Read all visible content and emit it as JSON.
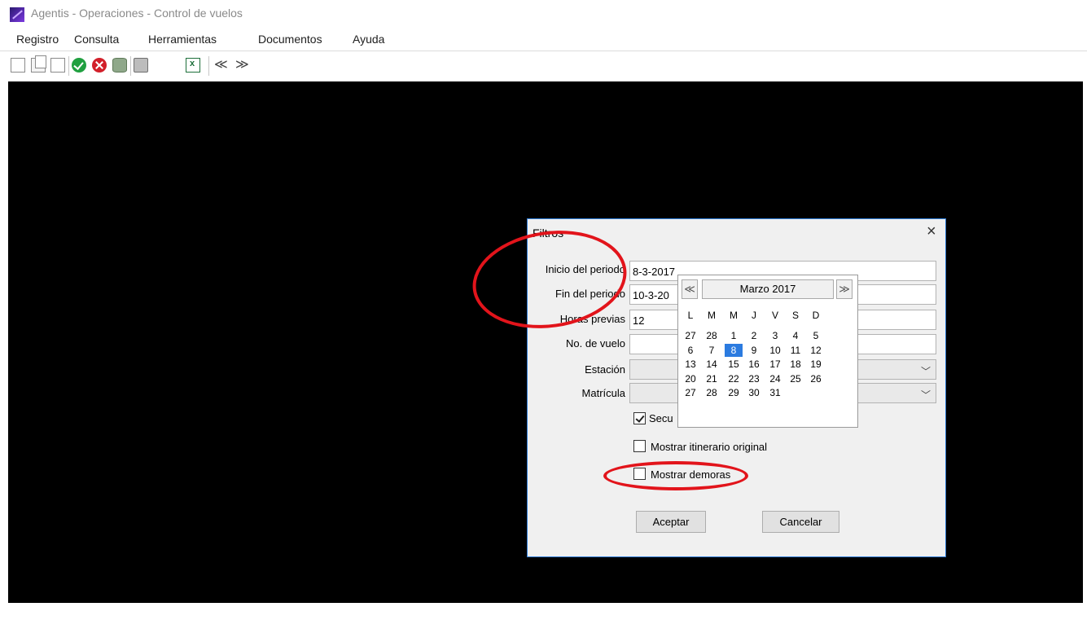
{
  "window": {
    "title": "Agentis - Operaciones - Control de vuelos"
  },
  "menu": [
    "Registro",
    "Consulta",
    "Herramientas",
    "Documentos",
    "Ayuda"
  ],
  "toolbar_icons": [
    "new-document-icon",
    "copy-document-icon",
    "edit-document-icon",
    "accept-icon",
    "cancel-icon",
    "database-icon",
    "print-icon",
    "excel-export-icon",
    "previous-icon",
    "next-icon"
  ],
  "dialog": {
    "title": "Filtros",
    "close": "×",
    "fields": {
      "inicio_label": "Inicio del periodo",
      "inicio_value": "8-3-2017",
      "fin_label": "Fin del periodo",
      "fin_value": "10-3-20",
      "horas_label": "Horas previas",
      "horas_value": "12",
      "vuelo_label": "No. de vuelo",
      "vuelo_value": "",
      "estacion_label": "Estación",
      "matricula_label": "Matrícula"
    },
    "checkboxes": {
      "secuencia_label": "Secu",
      "secuencia_checked": true,
      "itinerario_label": "Mostrar itinerario original",
      "itinerario_checked": false,
      "demoras_label": "Mostrar demoras",
      "demoras_checked": false
    },
    "buttons": {
      "accept": "Aceptar",
      "cancel": "Cancelar"
    }
  },
  "calendar": {
    "month_label": "Marzo 2017",
    "prev": "≪",
    "next": "≫",
    "weekdays": [
      "L",
      "M",
      "M",
      "J",
      "V",
      "S",
      "D"
    ],
    "selected_day": "8",
    "weeks": [
      [
        "27",
        "28",
        "1",
        "2",
        "3",
        "4",
        "5"
      ],
      [
        "6",
        "7",
        "8",
        "9",
        "10",
        "11",
        "12"
      ],
      [
        "13",
        "14",
        "15",
        "16",
        "17",
        "18",
        "19"
      ],
      [
        "20",
        "21",
        "22",
        "23",
        "24",
        "25",
        "26"
      ],
      [
        "27",
        "28",
        "29",
        "30",
        "31"
      ]
    ]
  },
  "colors": {
    "annotation": "#e2141b",
    "workspace": "#000000",
    "dialog_border": "#2e7bd6",
    "selected_day": "#2b7be0"
  }
}
